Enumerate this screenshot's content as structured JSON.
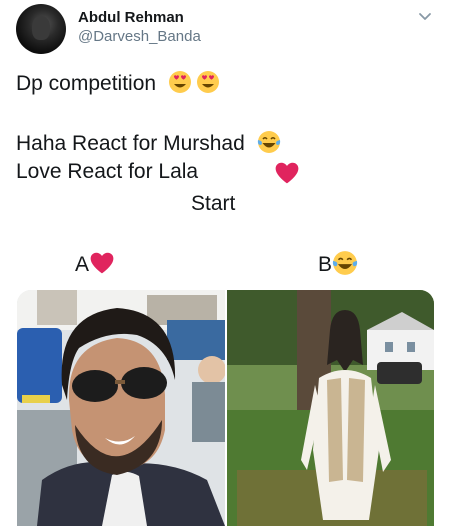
{
  "tweet": {
    "author_name": "Abdul Rehman",
    "author_handle": "@Darvesh_Banda",
    "line1": "Dp competition",
    "line2": "Haha React for Murshad",
    "line3": "Love React for Lala",
    "line4": "Start"
  },
  "photos": [
    {
      "label": "A",
      "emoji": "heart-emoji"
    },
    {
      "label": "B",
      "emoji": "laughing-emoji"
    }
  ],
  "icons": {
    "menu": "chevron-down-icon",
    "heart": "heart-emoji",
    "haha": "tears-of-joy-emoji",
    "love_eyes": "heart-eyes-emoji"
  },
  "colors": {
    "name": "#14171a",
    "handle": "#657786",
    "heart": "#e0245e",
    "emoji_face": "#ffcc4d"
  }
}
